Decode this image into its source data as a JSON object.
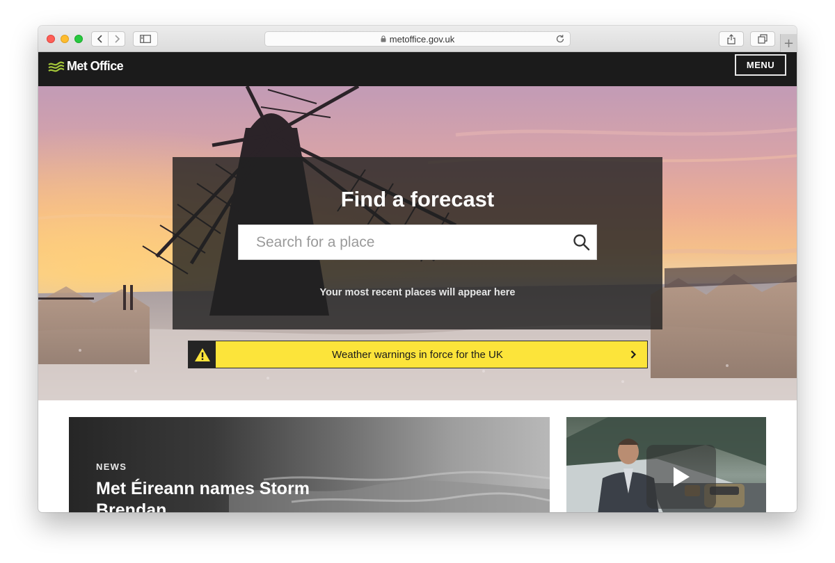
{
  "browser": {
    "url": "metoffice.gov.uk",
    "icons": [
      "back-icon",
      "forward-icon",
      "sidebar-icon",
      "lock-icon",
      "reload-icon",
      "share-icon",
      "tabs-icon",
      "plus-icon"
    ],
    "new_tab_label": "+"
  },
  "header": {
    "logo_text": "Met Office",
    "menu_label": "MENU",
    "colors": {
      "background": "#1b1b1b",
      "logo_green": "#a4c639"
    }
  },
  "hero": {
    "title": "Find a forecast",
    "search_placeholder": "Search for a place",
    "recent_places_text": "Your most recent places will appear here",
    "warning_text": "Weather warnings in force for the UK",
    "warning_icon": "warning-triangle-icon",
    "warning_color": "#fce43a"
  },
  "news": {
    "tag": "NEWS",
    "headline": "Met Éireann names Storm Brendan"
  },
  "video": {
    "play_icon": "play-icon"
  }
}
